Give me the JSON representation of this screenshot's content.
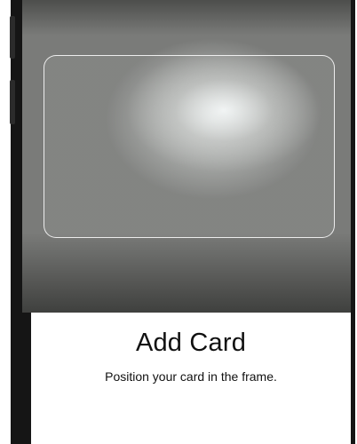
{
  "screen": {
    "title": "Add Card",
    "instruction": "Position your card in the frame."
  },
  "colors": {
    "frame": "#151515",
    "sheet_background": "#ffffff",
    "text": "#111111",
    "card_outline": "#ffffff"
  }
}
